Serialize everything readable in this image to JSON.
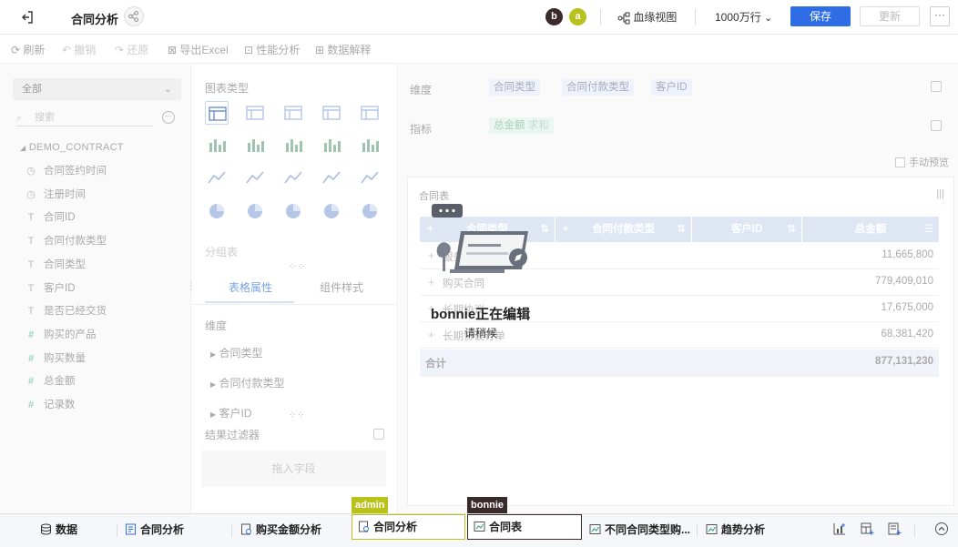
{
  "topbar": {
    "title": "合同分析",
    "avatars": [
      {
        "letter": "b",
        "color": "#3a2a2a"
      },
      {
        "letter": "a",
        "color": "#b9c21b"
      }
    ],
    "lineage_label": "血缘视图",
    "rows_label": "1000万行",
    "save_label": "保存",
    "update_label": "更新",
    "more_label": "···"
  },
  "toolbar": {
    "refresh": "刷新",
    "undo": "撤销",
    "redo": "还原",
    "export": "导出Excel",
    "perf": "性能分析",
    "explain": "数据解释"
  },
  "fields_panel": {
    "scope": "全部",
    "search_placeholder": "搜索",
    "dataset": "DEMO_CONTRACT",
    "fields": [
      {
        "type": "time",
        "icon": "◷",
        "label": "合同签约时间"
      },
      {
        "type": "time",
        "icon": "◷",
        "label": "注册时间"
      },
      {
        "type": "text",
        "icon": "T",
        "label": "合同ID"
      },
      {
        "type": "text",
        "icon": "T",
        "label": "合同付款类型"
      },
      {
        "type": "text",
        "icon": "T",
        "label": "合同类型"
      },
      {
        "type": "text",
        "icon": "T",
        "label": "客户ID"
      },
      {
        "type": "text",
        "icon": "T",
        "label": "是否已经交货"
      },
      {
        "type": "number",
        "icon": "#",
        "label": "购买的产品"
      },
      {
        "type": "number",
        "icon": "#",
        "label": "购买数量"
      },
      {
        "type": "number",
        "icon": "#",
        "label": "总金额"
      },
      {
        "type": "number",
        "icon": "#",
        "label": "记录数"
      }
    ]
  },
  "config_panel": {
    "chart_type_label": "图表类型",
    "group_table_label": "分组表",
    "tab_table_props": "表格属性",
    "tab_component_style": "组件样式",
    "dimension_label": "维度",
    "dimensions": [
      "合同类型",
      "合同付款类型",
      "客户ID"
    ],
    "filter_label": "结果过滤器",
    "filter_placeholder": "拖入字段"
  },
  "main": {
    "dimension_label": "维度",
    "dimension_chips": [
      "合同类型",
      "合同付款类型",
      "客户ID"
    ],
    "metric_label": "指标",
    "metric_chip": "总金额",
    "metric_agg": "求和",
    "manual_preview": "手动预览",
    "chart_title": "合同表",
    "columns": [
      "合同类型",
      "合同付款类型",
      "客户ID",
      "总金额"
    ],
    "rows": [
      {
        "name": "服务协议",
        "value": "11,665,800"
      },
      {
        "name": "购买合同",
        "value": "779,409,010"
      },
      {
        "name": "长期协议",
        "value": "17,675,000"
      },
      {
        "name": "长期协议订单",
        "value": "68,381,420"
      }
    ],
    "total_label": "合计",
    "total_value": "877,131,230"
  },
  "editing_overlay": {
    "title": "bonnie正在编辑",
    "subtitle": "请稍候"
  },
  "bottom": {
    "tabs": [
      {
        "label": "数据",
        "icon": "database-icon"
      },
      {
        "label": "合同分析",
        "icon": "report-icon"
      },
      {
        "label": "购买金额分析",
        "icon": "report-icon"
      },
      {
        "label": "合同分析",
        "icon": "report-icon"
      },
      {
        "label": "合同表",
        "icon": "chart-icon"
      },
      {
        "label": "不同合同类型购...",
        "icon": "chart-icon"
      },
      {
        "label": "趋势分析",
        "icon": "chart-icon"
      }
    ],
    "user_tag_a": "admin",
    "user_tag_b": "bonnie",
    "colors": {
      "admin": "#b9c21b",
      "bonnie": "#3a2a2a"
    }
  }
}
